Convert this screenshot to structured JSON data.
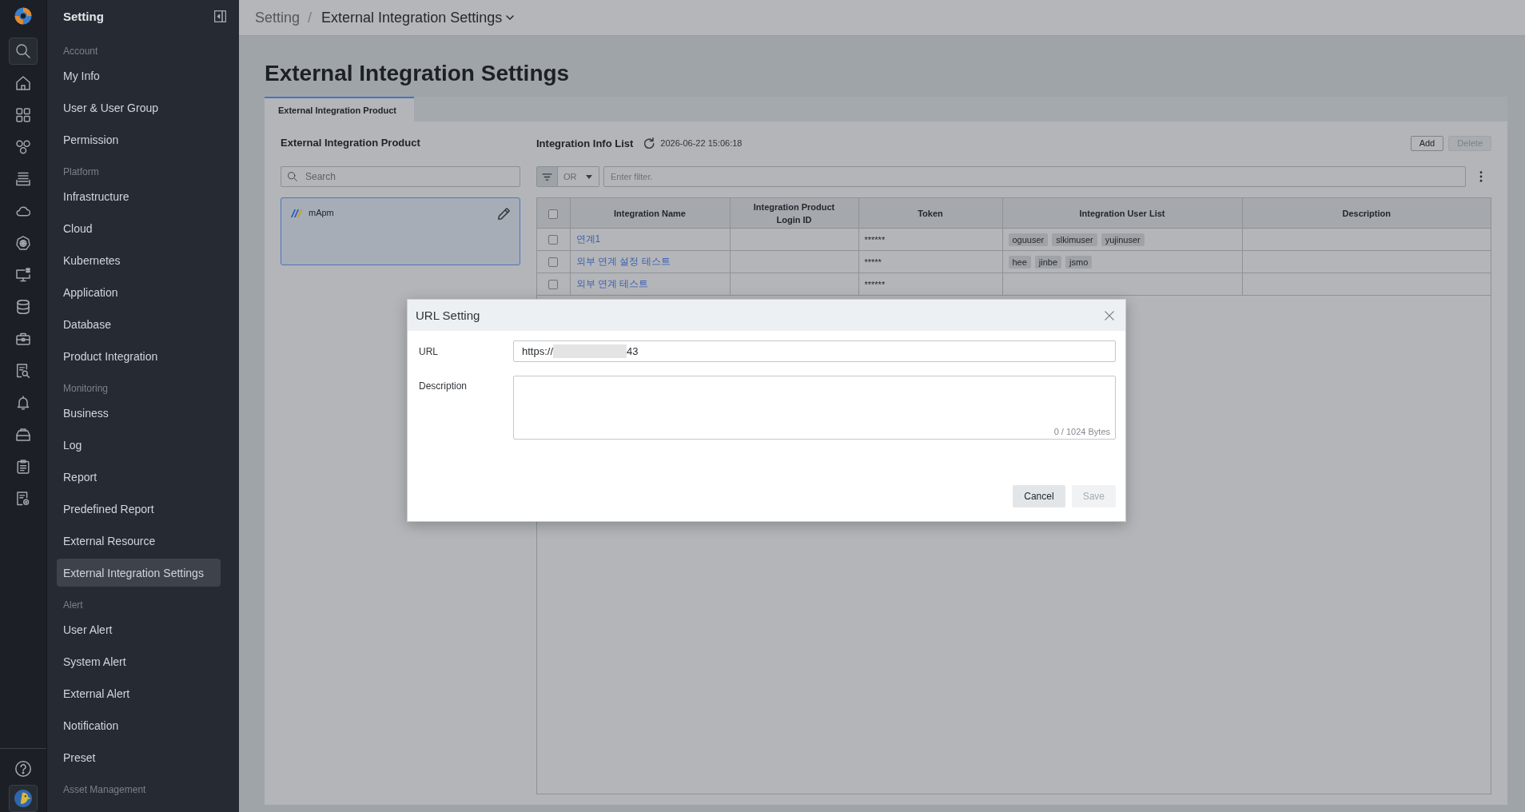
{
  "rail": {
    "items": [
      {
        "selected": true
      },
      {
        "selected": false
      },
      {
        "selected": false
      },
      {
        "selected": false
      },
      {
        "selected": false
      },
      {
        "selected": false
      },
      {
        "selected": false
      },
      {
        "selected": false
      },
      {
        "selected": false
      },
      {
        "selected": false
      },
      {
        "selected": false
      },
      {
        "selected": false
      },
      {
        "selected": false
      },
      {
        "selected": false
      },
      {
        "selected": false
      }
    ],
    "footer": [
      {
        "selected": false
      },
      {
        "selected": true
      }
    ]
  },
  "sidebar": {
    "title": "Setting",
    "groups": [
      {
        "label": "Account",
        "items": [
          {
            "label": "My Info",
            "selected": false
          },
          {
            "label": "User & User Group",
            "selected": false
          },
          {
            "label": "Permission",
            "selected": false
          }
        ]
      },
      {
        "label": "Platform",
        "items": [
          {
            "label": "Infrastructure",
            "selected": false
          },
          {
            "label": "Cloud",
            "selected": false
          },
          {
            "label": "Kubernetes",
            "selected": false
          },
          {
            "label": "Application",
            "selected": false
          },
          {
            "label": "Database",
            "selected": false
          },
          {
            "label": "Product Integration",
            "selected": false
          }
        ]
      },
      {
        "label": "Monitoring",
        "items": [
          {
            "label": "Business",
            "selected": false
          },
          {
            "label": "Log",
            "selected": false
          },
          {
            "label": "Report",
            "selected": false
          },
          {
            "label": "Predefined Report",
            "selected": false
          },
          {
            "label": "External Resource",
            "selected": false
          },
          {
            "label": "External Integration Settings",
            "selected": true
          }
        ]
      },
      {
        "label": "Alert",
        "items": [
          {
            "label": "User Alert",
            "selected": false
          },
          {
            "label": "System Alert",
            "selected": false
          },
          {
            "label": "External Alert",
            "selected": false
          },
          {
            "label": "Notification",
            "selected": false
          },
          {
            "label": "Preset",
            "selected": false
          }
        ]
      },
      {
        "label": "Asset Management"
      }
    ]
  },
  "header": {
    "breadcrumb": {
      "items": [
        "Setting",
        "External Integration Settings"
      ],
      "separator": "/"
    }
  },
  "page_title": "External Integration Settings",
  "tabs": [
    {
      "label": "External Integration Product",
      "selected": true
    }
  ],
  "product_panel": {
    "title": "External Integration Product",
    "search": {
      "placeholder": "Search"
    },
    "products": [
      {
        "name": "mApm",
        "selected": true
      }
    ]
  },
  "info_list": {
    "title": "Integration Info List",
    "updated": "2026-06-22 15:06:18",
    "buttons": [
      {
        "label": "Add",
        "disabled": false
      },
      {
        "label": "Delete",
        "disabled": true
      }
    ],
    "filter": {
      "operator": "OR",
      "placeholder": "Enter filter."
    },
    "table": {
      "all_checked": false,
      "columns": [
        "Integration Name",
        "Integration Product Login ID",
        "Token",
        "Integration User List",
        "Description"
      ],
      "rows": [
        {
          "checked": false,
          "name": "연계1",
          "token": "******",
          "users": [
            "oguuser",
            "slkimuser",
            "yujinuser"
          ]
        },
        {
          "checked": false,
          "name": "외부 연계 설정 테스트",
          "token": "*****",
          "users": [
            "hee",
            "jinbe",
            "jsmo"
          ]
        },
        {
          "checked": false,
          "name": "외부 연계 테스트",
          "token": "******"
        }
      ]
    }
  },
  "dialog": {
    "title": "URL Setting",
    "fields": [
      {
        "kind": "text",
        "label": "URL",
        "value_prefix": "https://",
        "redacted": true,
        "value_suffix": "43"
      },
      {
        "kind": "textarea",
        "label": "Description",
        "counter": "0 / 1024 Bytes"
      }
    ],
    "buttons": [
      {
        "label": "Cancel",
        "disabled": false
      },
      {
        "label": "Save",
        "disabled": true
      }
    ]
  }
}
